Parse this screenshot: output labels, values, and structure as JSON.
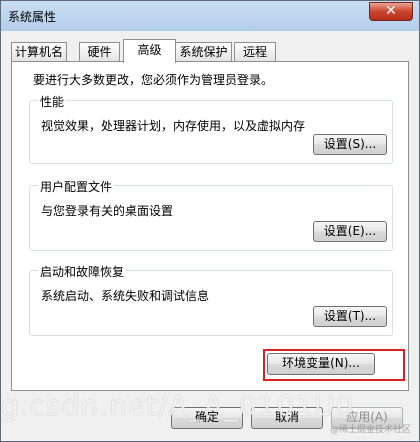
{
  "window": {
    "title": "系统属性",
    "close_label": "✕"
  },
  "tabs": [
    {
      "label": "计算机名",
      "active": false
    },
    {
      "label": "硬件",
      "active": false
    },
    {
      "label": "高级",
      "active": true
    },
    {
      "label": "系统保护",
      "active": false
    },
    {
      "label": "远程",
      "active": false
    }
  ],
  "panel": {
    "intro": "要进行大多数更改，您必须作为管理员登录。",
    "groups": [
      {
        "title": "性能",
        "description": "视觉效果，处理器计划，内存使用，以及虚拟内存",
        "button": "设置(S)..."
      },
      {
        "title": "用户配置文件",
        "description": "与您登录有关的桌面设置",
        "button": "设置(E)..."
      },
      {
        "title": "启动和故障恢复",
        "description": "系统启动、系统失败和调试信息",
        "button": "设置(T)..."
      }
    ],
    "env_button": "环境变量(N)..."
  },
  "footer": {
    "ok": "确定",
    "cancel": "取消",
    "apply": "应用(A)"
  },
  "overlay": {
    "watermark": "g.csdn.net/A_A_0101U0",
    "corner_mark": "@稀土掘金技术社区"
  },
  "colors": {
    "highlight": "#e02020",
    "titlebar": "#bcd4ee",
    "close": "#c8452f"
  }
}
